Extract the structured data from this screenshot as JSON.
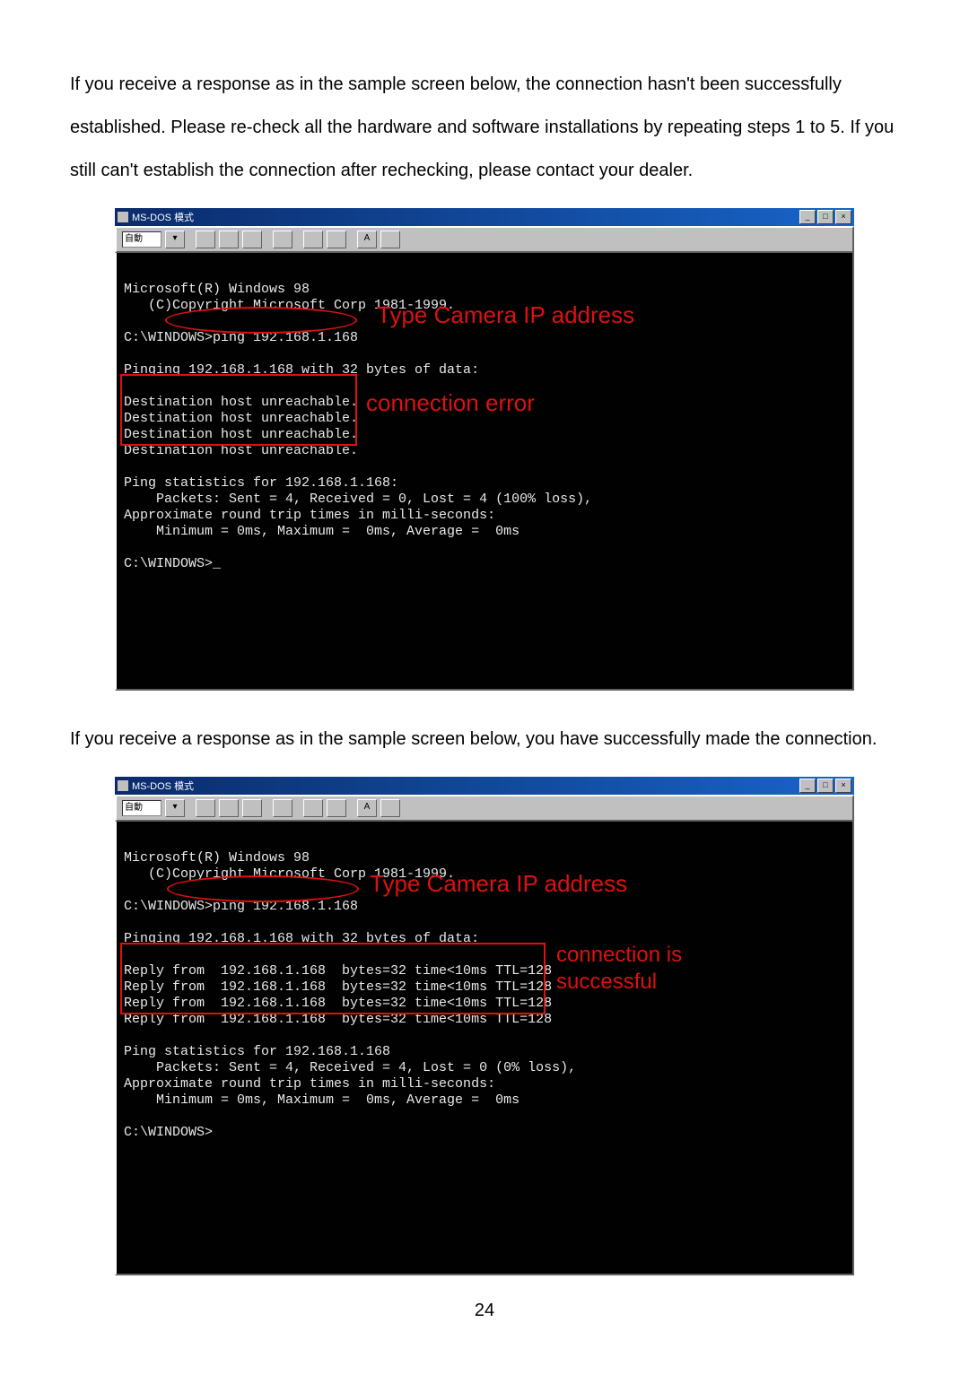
{
  "para1": "If you receive a response as in the sample screen below, the connection hasn't been successfully established. Please re-check all the hardware and software installations by repeating steps 1 to 5. If you still can't establish the connection after rechecking, please contact your dealer.",
  "para2": "If you receive a response as in the sample screen below, you have successfully made the connection.",
  "page_number": "24",
  "dos_window": {
    "title_prefix": "MS-DOS",
    "title_suffix": "模式",
    "min": "_",
    "max": "□",
    "close": "×",
    "toolbar_auto": "自動"
  },
  "console1": {
    "l1": "Microsoft(R) Windows 98",
    "l2": "   (C)Copyright Microsoft Corp 1981-1999.",
    "blank": "",
    "l3": "C:\\WINDOWS>ping 192.168.1.168",
    "l4": "Pinging 192.168.1.168 with 32 bytes of data:",
    "l5": "Destination host unreachable.",
    "l6": "Destination host unreachable.",
    "l7": "Destination host unreachable.",
    "l8": "Destination host unreachable.",
    "l9": "Ping statistics for 192.168.1.168:",
    "l10": "    Packets: Sent = 4, Received = 0, Lost = 4 (100% loss),",
    "l11": "Approximate round trip times in milli-seconds:",
    "l12": "    Minimum = 0ms, Maximum =  0ms, Average =  0ms",
    "l13": "C:\\WINDOWS>_",
    "anno_type": "Type Camera IP address",
    "anno_err": "connection error"
  },
  "console2": {
    "l1": "Microsoft(R) Windows 98",
    "l2": "   (C)Copyright Microsoft Corp 1981-1999.",
    "blank": "",
    "l3": "C:\\WINDOWS>ping 192.168.1.168",
    "l4": "Pinging 192.168.1.168 with 32 bytes of data:",
    "l5": "Reply from  192.168.1.168  bytes=32 time<10ms TTL=128",
    "l6": "Reply from  192.168.1.168  bytes=32 time<10ms TTL=128",
    "l7": "Reply from  192.168.1.168  bytes=32 time<10ms TTL=128",
    "l8": "Reply from  192.168.1.168  bytes=32 time<10ms TTL=128",
    "l9": "Ping statistics for 192.168.1.168",
    "l10": "    Packets: Sent = 4, Received = 4, Lost = 0 (0% loss),",
    "l11": "Approximate round trip times in milli-seconds:",
    "l12": "    Minimum = 0ms, Maximum =  0ms, Average =  0ms",
    "l13": "C:\\WINDOWS>",
    "anno_type": "Type Camera IP address",
    "anno_ok1": "connection is",
    "anno_ok2": "successful"
  }
}
